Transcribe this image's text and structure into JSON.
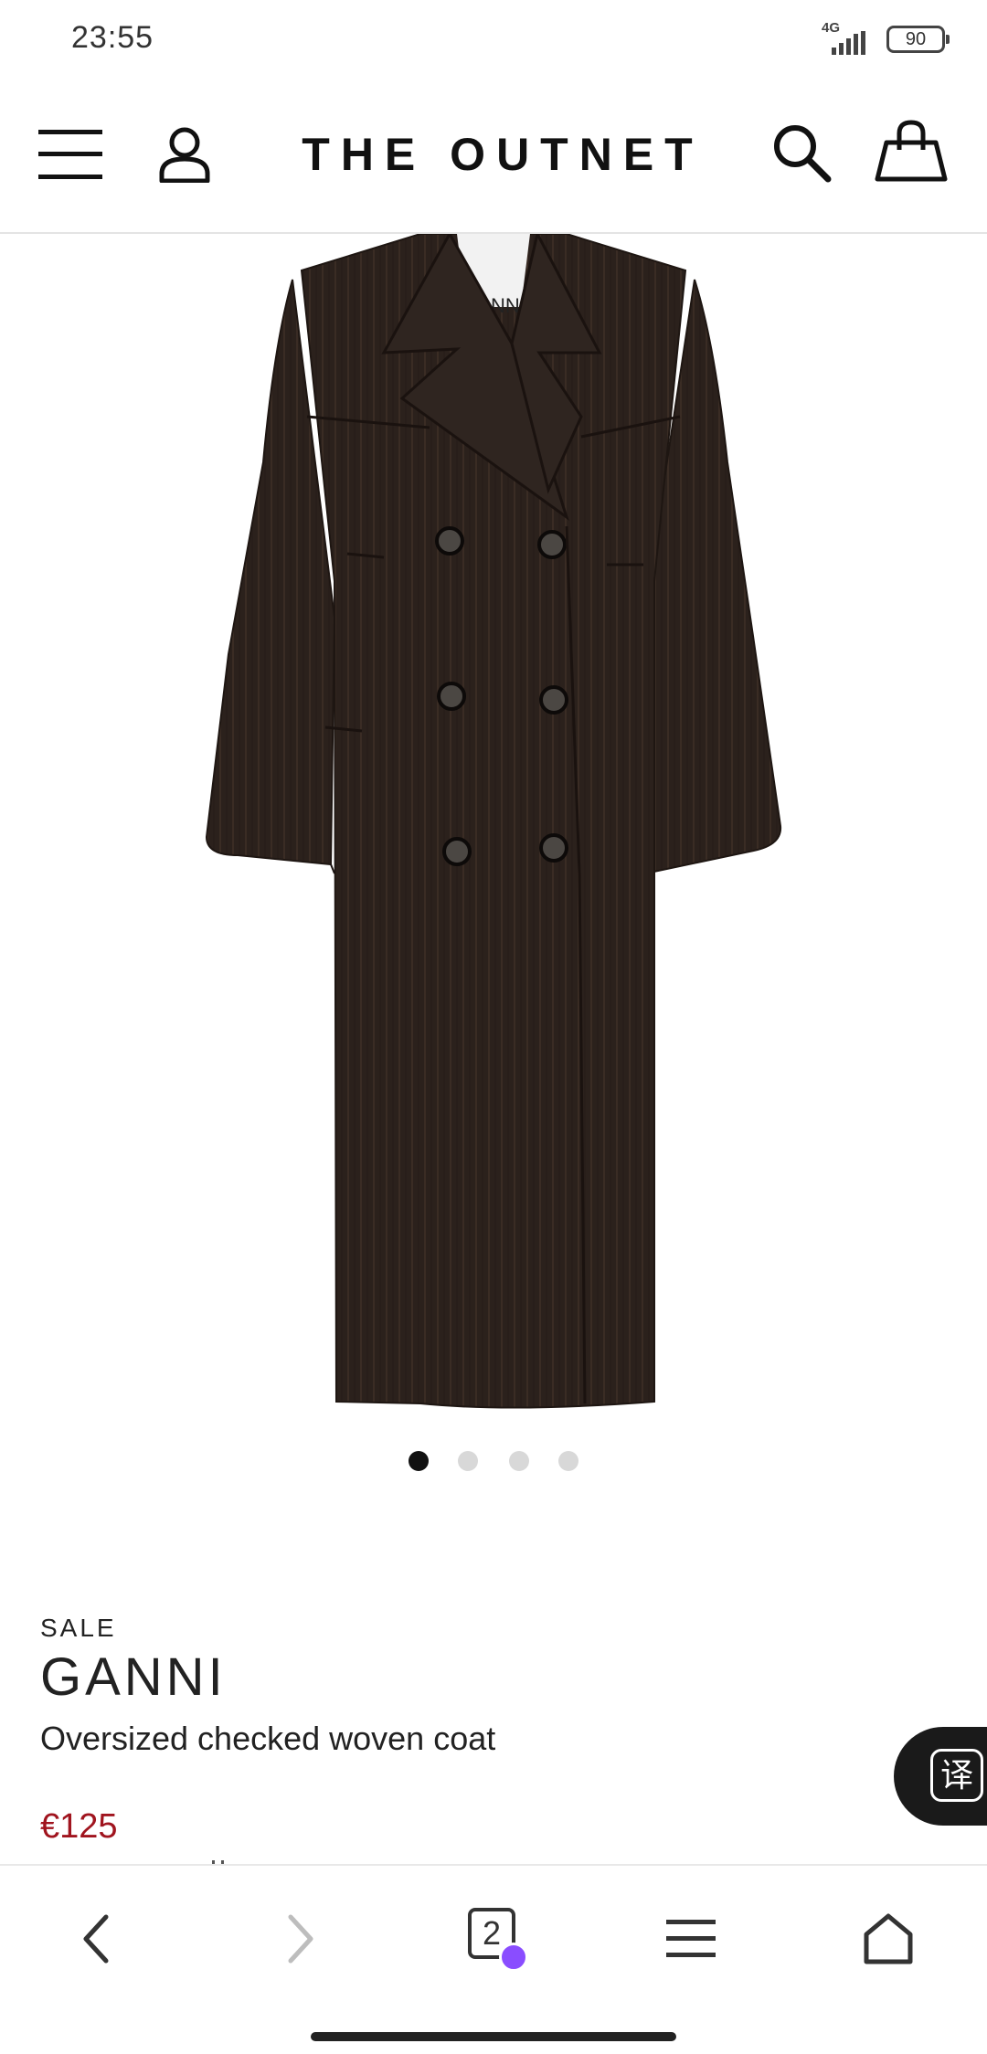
{
  "status_bar": {
    "time": "23:55",
    "network": "4G",
    "battery": "90"
  },
  "header": {
    "logo": "THE OUTNET",
    "icons": [
      "menu-icon",
      "account-icon",
      "search-icon",
      "shopping-bag-icon"
    ]
  },
  "gallery": {
    "image_alt": "Oversized checked woven coat",
    "coat_label": "GANNI",
    "slide_count": 4,
    "active_slide": 1
  },
  "product": {
    "badge": "SALE",
    "brand": "GANNI",
    "name": "Oversized checked woven coat",
    "price": "€125"
  },
  "translate_button": {
    "glyph": "译"
  },
  "browser_bar": {
    "tab_count": "2",
    "icons": [
      "back-arrow-icon",
      "forward-arrow-icon",
      "tabs-icon",
      "menu-icon",
      "home-icon"
    ]
  },
  "colors": {
    "price": "#a0141e",
    "coat": "#2b211c",
    "incognito": "#8a4dff"
  }
}
